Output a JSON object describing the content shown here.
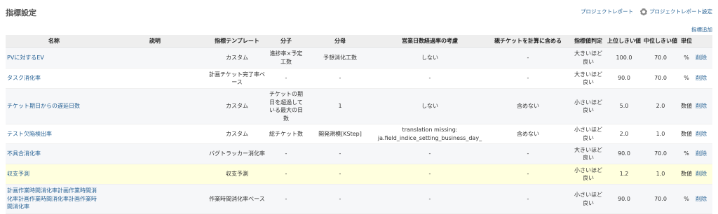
{
  "page": {
    "title": "指標設定"
  },
  "top_links": {
    "report": "プロジェクトレポート",
    "report_settings": "プロジェクトレポート設定"
  },
  "add_link": "指標追加",
  "columns": [
    "名称",
    "説明",
    "指標テンプレート",
    "分子",
    "分母",
    "営業日数経過率の考慮",
    "親チケットを計算に含める",
    "指標値判定",
    "上位しきい値",
    "中位しきい値",
    "単位",
    ""
  ],
  "rows": [
    {
      "name": "PVに対するEV",
      "description": "",
      "template": "カスタム",
      "numerator": "進捗率×予定工数",
      "denominator": "予想消化工数",
      "business_day": "しない",
      "parent": "-",
      "judge": "大きいほど良い",
      "upper": "100.0",
      "middle": "70.0",
      "unit": "%",
      "delete": "削除"
    },
    {
      "name": "タスク消化率",
      "description": "",
      "template": "計画チケット完了率ベース",
      "numerator": "-",
      "denominator": "-",
      "business_day": "-",
      "parent": "-",
      "judge": "大きいほど良い",
      "upper": "90.0",
      "middle": "70.0",
      "unit": "%",
      "delete": "削除"
    },
    {
      "name": "チケット期日からの遅延日数",
      "description": "",
      "template": "カスタム",
      "numerator": "チケットの期日を超過している最大の日数",
      "denominator": "1",
      "business_day": "しない",
      "parent": "含めない",
      "judge": "小さいほど良い",
      "upper": "5.0",
      "middle": "2.0",
      "unit": "数値",
      "delete": "削除"
    },
    {
      "name": "テスト欠陥検出率",
      "description": "",
      "template": "カスタム",
      "numerator": "総チケット数",
      "denominator": "開発規模[KStep]",
      "business_day": "translation missing: ja.field_indice_setting_business_day_",
      "parent": "含めない",
      "judge": "小さいほど良い",
      "upper": "2.0",
      "middle": "1.0",
      "unit": "数値",
      "delete": "削除"
    },
    {
      "name": "不具合消化率",
      "description": "",
      "template": "バグトラッカー消化率",
      "numerator": "-",
      "denominator": "-",
      "business_day": "-",
      "parent": "-",
      "judge": "大きいほど良い",
      "upper": "90.0",
      "middle": "70.0",
      "unit": "%",
      "delete": "削除"
    },
    {
      "name": "収支予測",
      "description": "",
      "template": "収支予測",
      "numerator": "-",
      "denominator": "-",
      "business_day": "-",
      "parent": "-",
      "judge": "小さいほど良い",
      "upper": "1.2",
      "middle": "1.0",
      "unit": "数値",
      "delete": "削除"
    },
    {
      "name": "計画作業時間消化率計画作業時間消化率計画作業時間消化率計画作業時間消化率",
      "description": "",
      "template": "作業時間消化率ベース",
      "numerator": "-",
      "denominator": "-",
      "business_day": "-",
      "parent": "-",
      "judge": "小さいほど良い",
      "upper": "90.0",
      "middle": "70.0",
      "unit": "%",
      "delete": "削除"
    }
  ]
}
